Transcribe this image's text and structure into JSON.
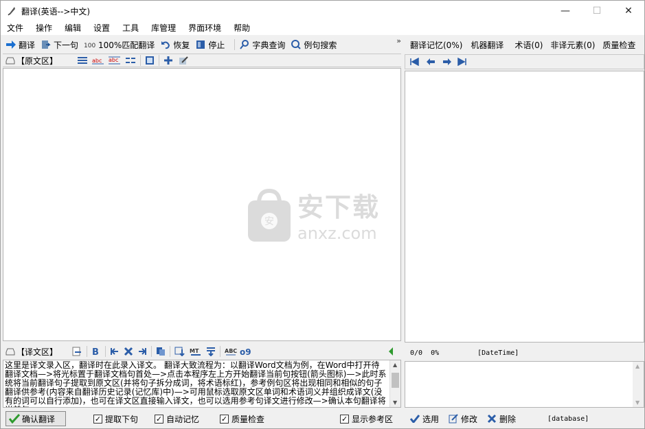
{
  "window": {
    "title": "翻译(英语-->中文)",
    "min": "—",
    "max": "☐",
    "close": "✕"
  },
  "menu": [
    "文件",
    "操作",
    "编辑",
    "设置",
    "工具",
    "库管理",
    "界面环境",
    "帮助"
  ],
  "toolbar": {
    "translate": "翻译",
    "next": "下一句",
    "match": "100%匹配翻译",
    "restore": "恢复",
    "stop": "停止",
    "dict": "字典查询",
    "example": "例句搜索",
    "more": "»"
  },
  "source": {
    "header": "【原文区】"
  },
  "target": {
    "header": "【译文区】",
    "text": "这里是译文录入区，翻译时在此录入译文。 翻译大致流程为：以翻译Word文档为例，在Word中打开待翻译文档—>将光标置于翻译文档句首处—>点击本程序左上方开始翻译当前句按钮(箭头图标)—>此时系统将当前翻译句子提取到原文区(并将句子拆分成词，将术语标红)，参考例句区将出现相同和相似的句子翻译供参考(内容来自翻译历史记录(记忆库)中)—>可用鼠标选取原文区单词和术语词义并组织成译文(没有的词可以自行添加)，也可在译文区直接输入译文，也可以选用参考句译文进行修改—>确认本句翻译将当前句"
  },
  "bottom_left": {
    "confirm": "确认翻译",
    "opt1": "提取下句",
    "opt2": "自动记忆",
    "opt3": "质量检查",
    "opt4": "显示参考区"
  },
  "right_tabs": [
    "翻译记忆(0%)",
    "机器翻译",
    "术语(0)",
    "非译元素(0)",
    "质量检查"
  ],
  "right_status": {
    "count": "0/0",
    "percent": "0%",
    "datetime": "[DateTime]"
  },
  "right_bottom": {
    "select": "选用",
    "edit": "修改",
    "delete": "删除",
    "db": "[database]"
  },
  "watermark": {
    "cn": "安下载",
    "en": "anxz.com"
  }
}
